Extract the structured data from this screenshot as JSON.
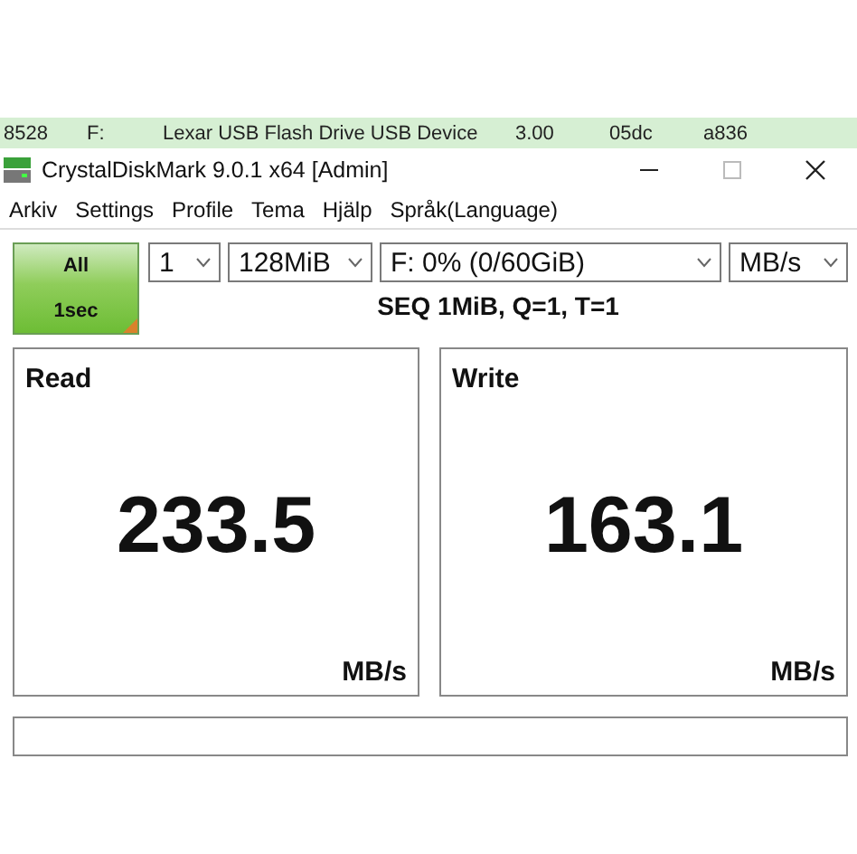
{
  "background_row": {
    "cells": [
      "8528",
      "F:",
      "Lexar USB Flash Drive USB Device",
      "3.00",
      "05dc",
      "a836"
    ]
  },
  "window": {
    "title": "CrystalDiskMark 9.0.1 x64 [Admin]"
  },
  "menu": [
    "Arkiv",
    "Settings",
    "Profile",
    "Tema",
    "Hjälp",
    "Språk(Language)"
  ],
  "all_button": {
    "label": "All",
    "sublabel": "1sec"
  },
  "dropdowns": [
    {
      "value": "1"
    },
    {
      "value": "128MiB"
    },
    {
      "value": "F: 0% (0/60GiB)"
    },
    {
      "value": "MB/s"
    }
  ],
  "test_label": "SEQ 1MiB, Q=1, T=1",
  "panels": [
    {
      "title": "Read",
      "value": "233.5",
      "unit": "MB/s"
    },
    {
      "title": "Write",
      "value": "163.1",
      "unit": "MB/s"
    }
  ]
}
